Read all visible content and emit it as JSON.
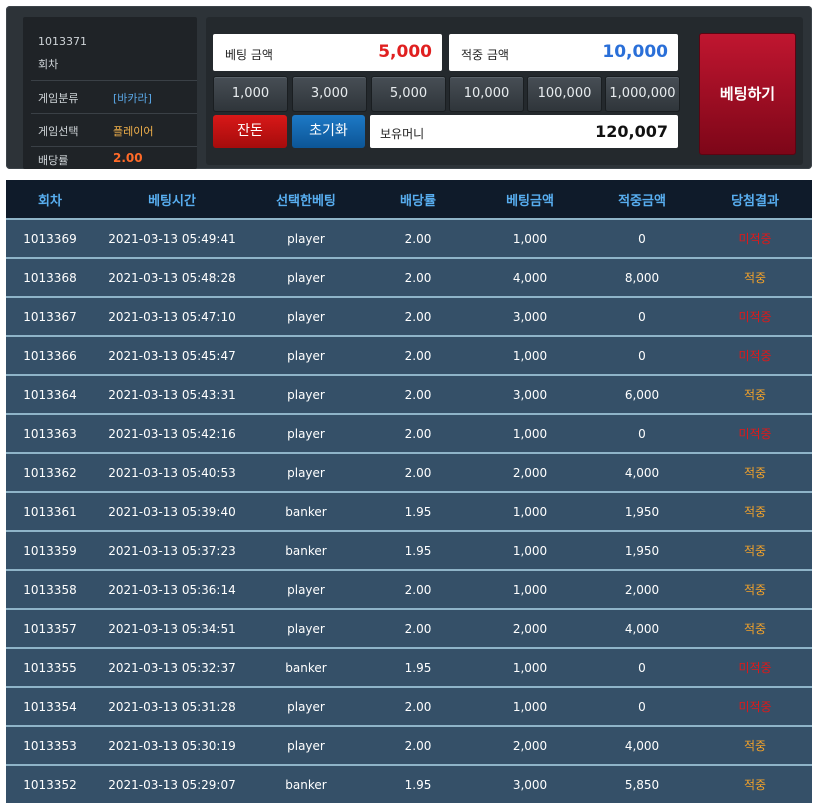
{
  "info": {
    "round_number": "1013371",
    "round_label": "회차",
    "game_type_label": "게임분류",
    "game_type_value": "[바카라]",
    "game_select_label": "게임선택",
    "game_select_value": "플레이어",
    "odds_label": "배당률",
    "odds_value": "2.00"
  },
  "bet": {
    "bet_amount_label": "베팅 금액",
    "bet_amount_value": "5,000",
    "win_amount_label": "적중 금액",
    "win_amount_value": "10,000",
    "chips": [
      "1,000",
      "3,000",
      "5,000",
      "10,000",
      "100,000",
      "1,000,000"
    ],
    "reset_label": "잔돈",
    "init_label": "초기화",
    "money_label": "보유머니",
    "money_value": "120,007",
    "bet_button_label": "베팅하기"
  },
  "colors": {
    "bet_amount": "#e02020",
    "win_amount": "#2a6fd8",
    "result_win": "#f2a22a",
    "result_lose": "#e01818",
    "header_text": "#58aef0",
    "row_bg": "#355068"
  },
  "table": {
    "headers": [
      "회차",
      "베팅시간",
      "선택한베팅",
      "배당률",
      "베팅금액",
      "적중금액",
      "당첨결과"
    ],
    "rows": [
      {
        "round": "1013369",
        "time": "2021-03-13 05:49:41",
        "pick": "player",
        "odds": "2.00",
        "bet": "1,000",
        "win": "0",
        "result": "미적중",
        "status": "lose"
      },
      {
        "round": "1013368",
        "time": "2021-03-13 05:48:28",
        "pick": "player",
        "odds": "2.00",
        "bet": "4,000",
        "win": "8,000",
        "result": "적중",
        "status": "win"
      },
      {
        "round": "1013367",
        "time": "2021-03-13 05:47:10",
        "pick": "player",
        "odds": "2.00",
        "bet": "3,000",
        "win": "0",
        "result": "미적중",
        "status": "lose"
      },
      {
        "round": "1013366",
        "time": "2021-03-13 05:45:47",
        "pick": "player",
        "odds": "2.00",
        "bet": "1,000",
        "win": "0",
        "result": "미적중",
        "status": "lose"
      },
      {
        "round": "1013364",
        "time": "2021-03-13 05:43:31",
        "pick": "player",
        "odds": "2.00",
        "bet": "3,000",
        "win": "6,000",
        "result": "적중",
        "status": "win"
      },
      {
        "round": "1013363",
        "time": "2021-03-13 05:42:16",
        "pick": "player",
        "odds": "2.00",
        "bet": "1,000",
        "win": "0",
        "result": "미적중",
        "status": "lose"
      },
      {
        "round": "1013362",
        "time": "2021-03-13 05:40:53",
        "pick": "player",
        "odds": "2.00",
        "bet": "2,000",
        "win": "4,000",
        "result": "적중",
        "status": "win"
      },
      {
        "round": "1013361",
        "time": "2021-03-13 05:39:40",
        "pick": "banker",
        "odds": "1.95",
        "bet": "1,000",
        "win": "1,950",
        "result": "적중",
        "status": "win"
      },
      {
        "round": "1013359",
        "time": "2021-03-13 05:37:23",
        "pick": "banker",
        "odds": "1.95",
        "bet": "1,000",
        "win": "1,950",
        "result": "적중",
        "status": "win"
      },
      {
        "round": "1013358",
        "time": "2021-03-13 05:36:14",
        "pick": "player",
        "odds": "2.00",
        "bet": "1,000",
        "win": "2,000",
        "result": "적중",
        "status": "win"
      },
      {
        "round": "1013357",
        "time": "2021-03-13 05:34:51",
        "pick": "player",
        "odds": "2.00",
        "bet": "2,000",
        "win": "4,000",
        "result": "적중",
        "status": "win"
      },
      {
        "round": "1013355",
        "time": "2021-03-13 05:32:37",
        "pick": "banker",
        "odds": "1.95",
        "bet": "1,000",
        "win": "0",
        "result": "미적중",
        "status": "lose"
      },
      {
        "round": "1013354",
        "time": "2021-03-13 05:31:28",
        "pick": "player",
        "odds": "2.00",
        "bet": "1,000",
        "win": "0",
        "result": "미적중",
        "status": "lose"
      },
      {
        "round": "1013353",
        "time": "2021-03-13 05:30:19",
        "pick": "player",
        "odds": "2.00",
        "bet": "2,000",
        "win": "4,000",
        "result": "적중",
        "status": "win"
      },
      {
        "round": "1013352",
        "time": "2021-03-13 05:29:07",
        "pick": "banker",
        "odds": "1.95",
        "bet": "3,000",
        "win": "5,850",
        "result": "적중",
        "status": "win"
      }
    ]
  }
}
